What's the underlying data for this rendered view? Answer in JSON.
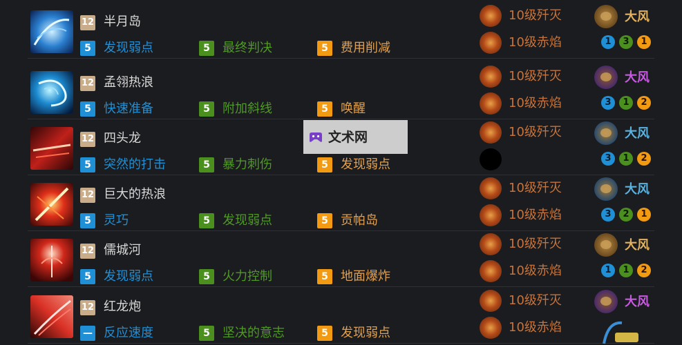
{
  "watermark": {
    "text": "文术网"
  },
  "rows": [
    {
      "name": "半月岛",
      "level": "12",
      "icon": "blue-wave-icon",
      "perks": [
        {
          "tier": "5",
          "label": "发现弱点"
        },
        {
          "tier": "5",
          "label": "最终判决"
        },
        {
          "tier": "5",
          "label": "费用削减"
        }
      ],
      "gem1": "10级歼灭",
      "gem2": "10级赤焰",
      "gem2_empty": false,
      "wind_label": "大风",
      "wind_color": "gold",
      "dots": [
        {
          "v": "1",
          "c": "c1"
        },
        {
          "v": "3",
          "c": "c2"
        },
        {
          "v": "1",
          "c": "c3"
        }
      ]
    },
    {
      "name": "孟翎热浪",
      "level": "12",
      "icon": "blue-vortex-icon",
      "perks": [
        {
          "tier": "5",
          "label": "快速准备"
        },
        {
          "tier": "5",
          "label": "附加斜线"
        },
        {
          "tier": "5",
          "label": "唤醒"
        }
      ],
      "gem1": "10级歼灭",
      "gem2": "10级赤焰",
      "gem2_empty": false,
      "wind_label": "大风",
      "wind_color": "purple",
      "dots": [
        {
          "v": "3",
          "c": "c1"
        },
        {
          "v": "1",
          "c": "c2"
        },
        {
          "v": "2",
          "c": "c3"
        }
      ]
    },
    {
      "name": "四头龙",
      "level": "12",
      "icon": "red-slash-icon",
      "perks": [
        {
          "tier": "5",
          "label": "突然的打击"
        },
        {
          "tier": "5",
          "label": "暴力刺伤"
        },
        {
          "tier": "5",
          "label": "发现弱点"
        }
      ],
      "gem1": "10级歼灭",
      "gem2": "",
      "gem2_empty": true,
      "wind_label": "大风",
      "wind_color": "blue",
      "dots": [
        {
          "v": "3",
          "c": "c1"
        },
        {
          "v": "1",
          "c": "c2"
        },
        {
          "v": "2",
          "c": "c3"
        }
      ]
    },
    {
      "name": "巨大的热浪",
      "level": "12",
      "icon": "red-cross-slash-icon",
      "perks": [
        {
          "tier": "5",
          "label": "灵巧"
        },
        {
          "tier": "5",
          "label": "发现弱点"
        },
        {
          "tier": "5",
          "label": "贡帕岛"
        }
      ],
      "gem1": "10级歼灭",
      "gem2": "10级赤焰",
      "gem2_empty": false,
      "wind_label": "大风",
      "wind_color": "blue",
      "dots": [
        {
          "v": "3",
          "c": "c1"
        },
        {
          "v": "2",
          "c": "c2"
        },
        {
          "v": "1",
          "c": "c3"
        }
      ]
    },
    {
      "name": "儒城河",
      "level": "12",
      "icon": "red-burst-icon",
      "perks": [
        {
          "tier": "5",
          "label": "发现弱点"
        },
        {
          "tier": "5",
          "label": "火力控制"
        },
        {
          "tier": "5",
          "label": "地面爆炸"
        }
      ],
      "gem1": "10级歼灭",
      "gem2": "10级赤焰",
      "gem2_empty": false,
      "wind_label": "大风",
      "wind_color": "gold",
      "dots": [
        {
          "v": "1",
          "c": "c1"
        },
        {
          "v": "1",
          "c": "c2"
        },
        {
          "v": "2",
          "c": "c3"
        }
      ]
    },
    {
      "name": "红龙炮",
      "level": "12",
      "icon": "red-dragon-slash-icon",
      "perks": [
        {
          "tier": "—",
          "label": "反应速度"
        },
        {
          "tier": "5",
          "label": "坚决的意志"
        },
        {
          "tier": "5",
          "label": "发现弱点"
        }
      ],
      "gem1": "10级歼灭",
      "gem2": "10级赤焰",
      "gem2_empty": false,
      "wind_label": "大风",
      "wind_color": "purple",
      "dots": []
    }
  ]
}
